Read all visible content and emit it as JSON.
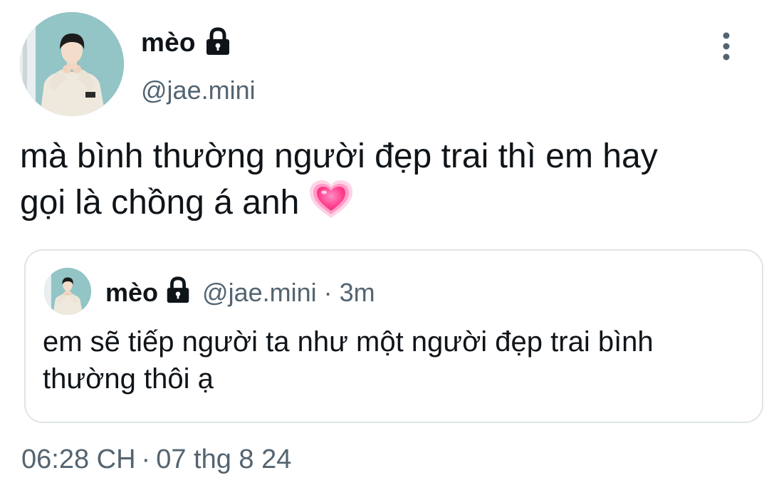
{
  "author": {
    "display_name": "mèo",
    "handle": "@jae.mini",
    "protected": true
  },
  "tweet": {
    "text_line1": "mà bình thường người đẹp trai thì em hay",
    "text_line2": "gọi là chồng á anh",
    "emoji": "growing-heart-icon"
  },
  "quoted_tweet": {
    "display_name": "mèo",
    "handle": "@jae.mini",
    "separator": "·",
    "time": "3m",
    "text_line1": "em sẽ tiếp người ta như một người đẹp trai bình",
    "text_line2": "thường thôi ạ"
  },
  "meta": {
    "time": "06:28 CH",
    "separator": "·",
    "date": "07 thg 8 24"
  },
  "colors": {
    "text": "#0f1419",
    "secondary": "#536471",
    "border": "#dfe4e8",
    "heart": "#ff4f9a"
  }
}
